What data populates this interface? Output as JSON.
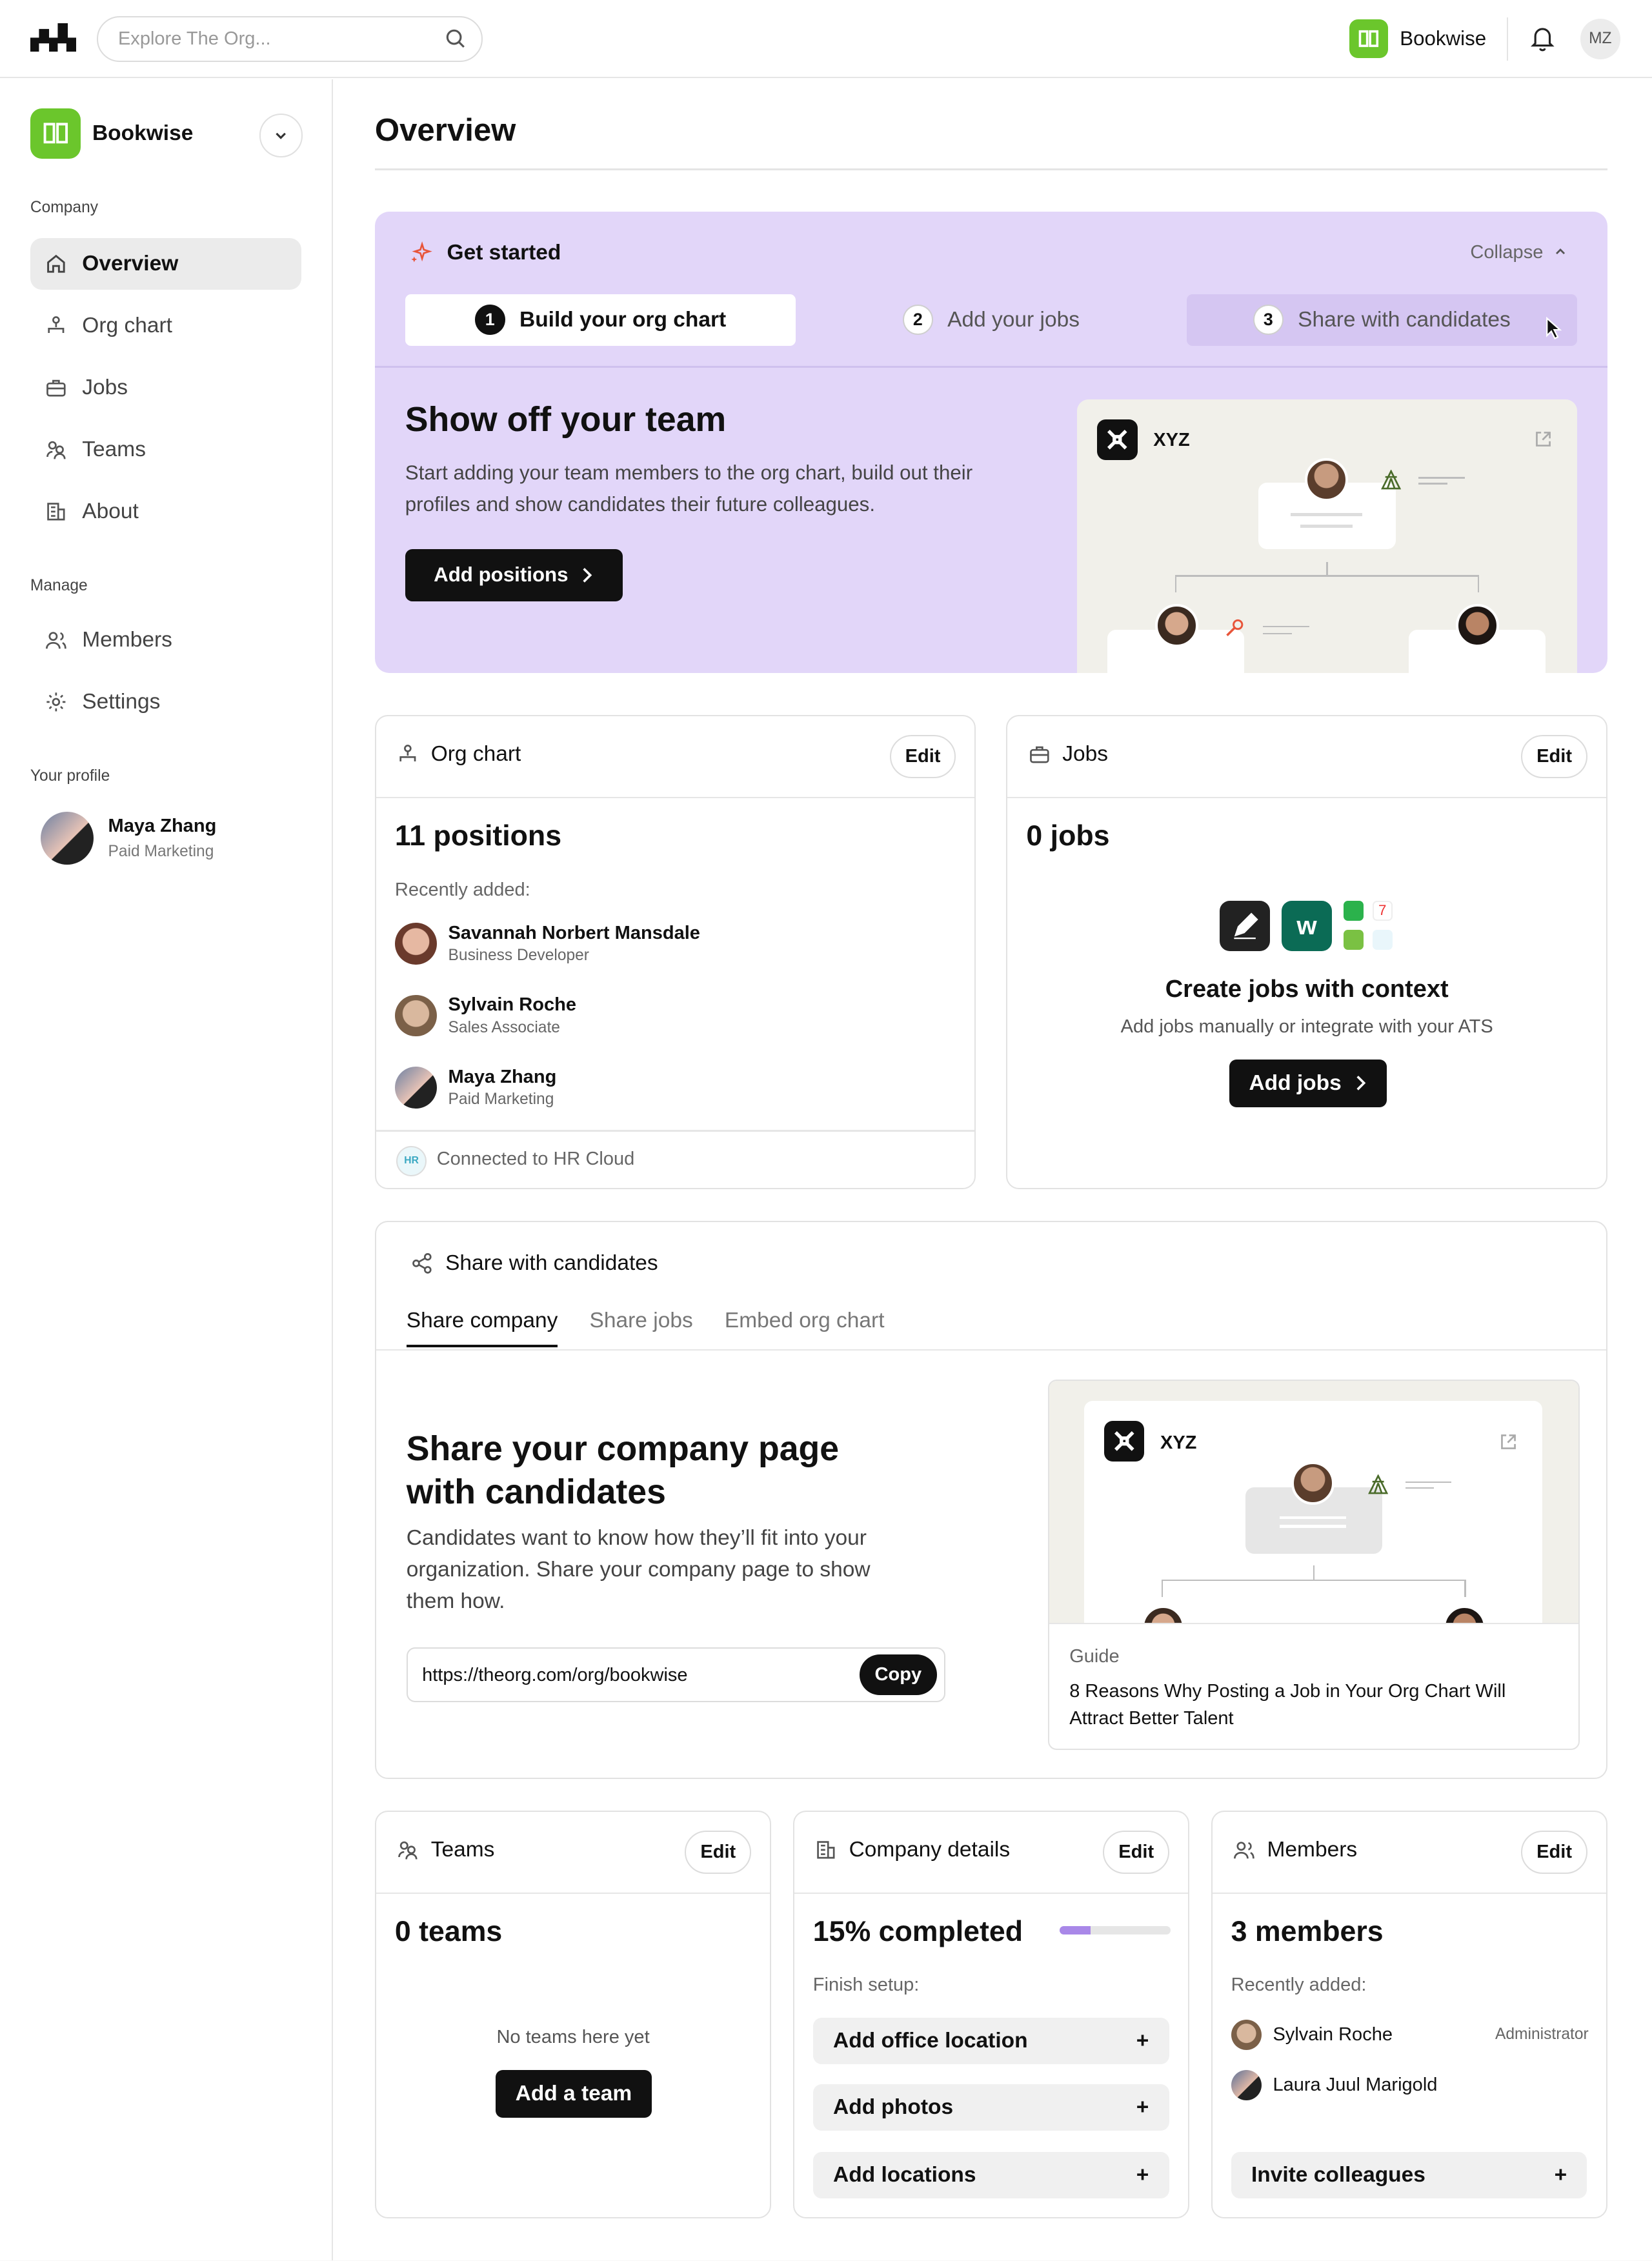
{
  "topbar": {
    "search_placeholder": "Explore The Org...",
    "brand": "Bookwise",
    "user_initials": "MZ"
  },
  "sidebar": {
    "brand": "Bookwise",
    "sections": {
      "company": "Company",
      "manage": "Manage",
      "profile": "Your profile"
    },
    "items": [
      {
        "label": "Overview",
        "icon": "home-icon",
        "active": true
      },
      {
        "label": "Org chart",
        "icon": "org-chart-icon"
      },
      {
        "label": "Jobs",
        "icon": "briefcase-icon"
      },
      {
        "label": "Teams",
        "icon": "teams-icon"
      },
      {
        "label": "About",
        "icon": "building-icon"
      },
      {
        "label": "Members",
        "icon": "people-icon"
      },
      {
        "label": "Settings",
        "icon": "gear-icon"
      }
    ],
    "profile": {
      "name": "Maya Zhang",
      "role": "Paid Marketing"
    }
  },
  "page_title": "Overview",
  "get_started": {
    "title": "Get started",
    "collapse": "Collapse",
    "steps": [
      {
        "num": "1",
        "label": "Build your org chart"
      },
      {
        "num": "2",
        "label": "Add your jobs"
      },
      {
        "num": "3",
        "label": "Share with candidates"
      }
    ],
    "hero_title": "Show off your team",
    "hero_desc": "Start adding your team members to the org chart, build out their profiles and show candidates their future colleagues.",
    "button": "Add positions",
    "preview_name": "XYZ"
  },
  "org_chart": {
    "title": "Org chart",
    "edit": "Edit",
    "count": "11 positions",
    "recent_label": "Recently added:",
    "people": [
      {
        "name": "Savannah Norbert Mansdale",
        "role": "Business Developer"
      },
      {
        "name": "Sylvain Roche",
        "role": "Sales Associate"
      },
      {
        "name": "Maya Zhang",
        "role": "Paid Marketing"
      }
    ],
    "hr_badge": "HR",
    "connected": "Connected to HR Cloud"
  },
  "jobs": {
    "title": "Jobs",
    "edit": "Edit",
    "count": "0 jobs",
    "heading": "Create jobs with context",
    "desc": "Add jobs manually or integrate with your ATS",
    "button": "Add jobs"
  },
  "share": {
    "title": "Share with candidates",
    "tabs": [
      "Share company",
      "Share jobs",
      "Embed org chart"
    ],
    "heading": "Share your company page with candidates",
    "desc": "Candidates want to know how they’ll fit into your organization. Share your company page to show them how.",
    "url": "https://theorg.com/org/bookwise",
    "copy": "Copy",
    "preview_name": "XYZ",
    "guide_label": "Guide",
    "guide_title": "8 Reasons Why Posting a Job in Your Org Chart Will Attract Better Talent"
  },
  "teams": {
    "title": "Teams",
    "edit": "Edit",
    "count": "0 teams",
    "empty": "No teams here yet",
    "button": "Add a team"
  },
  "company_details": {
    "title": "Company details",
    "edit": "Edit",
    "completed": "15% completed",
    "progress": 0.28,
    "finish_label": "Finish setup:",
    "rows": [
      "Add office location",
      "Add photos",
      "Add locations"
    ]
  },
  "members": {
    "title": "Members",
    "edit": "Edit",
    "count": "3 members",
    "recent_label": "Recently added:",
    "people": [
      {
        "name": "Sylvain Roche",
        "badge": "Administrator"
      },
      {
        "name": "Laura Juul Marigold",
        "badge": ""
      }
    ],
    "invite": "Invite colleagues"
  },
  "colors": {
    "brand_green": "#6bc62c",
    "get_started_bg": "#e2d6f9",
    "progress": "#a988e8"
  }
}
